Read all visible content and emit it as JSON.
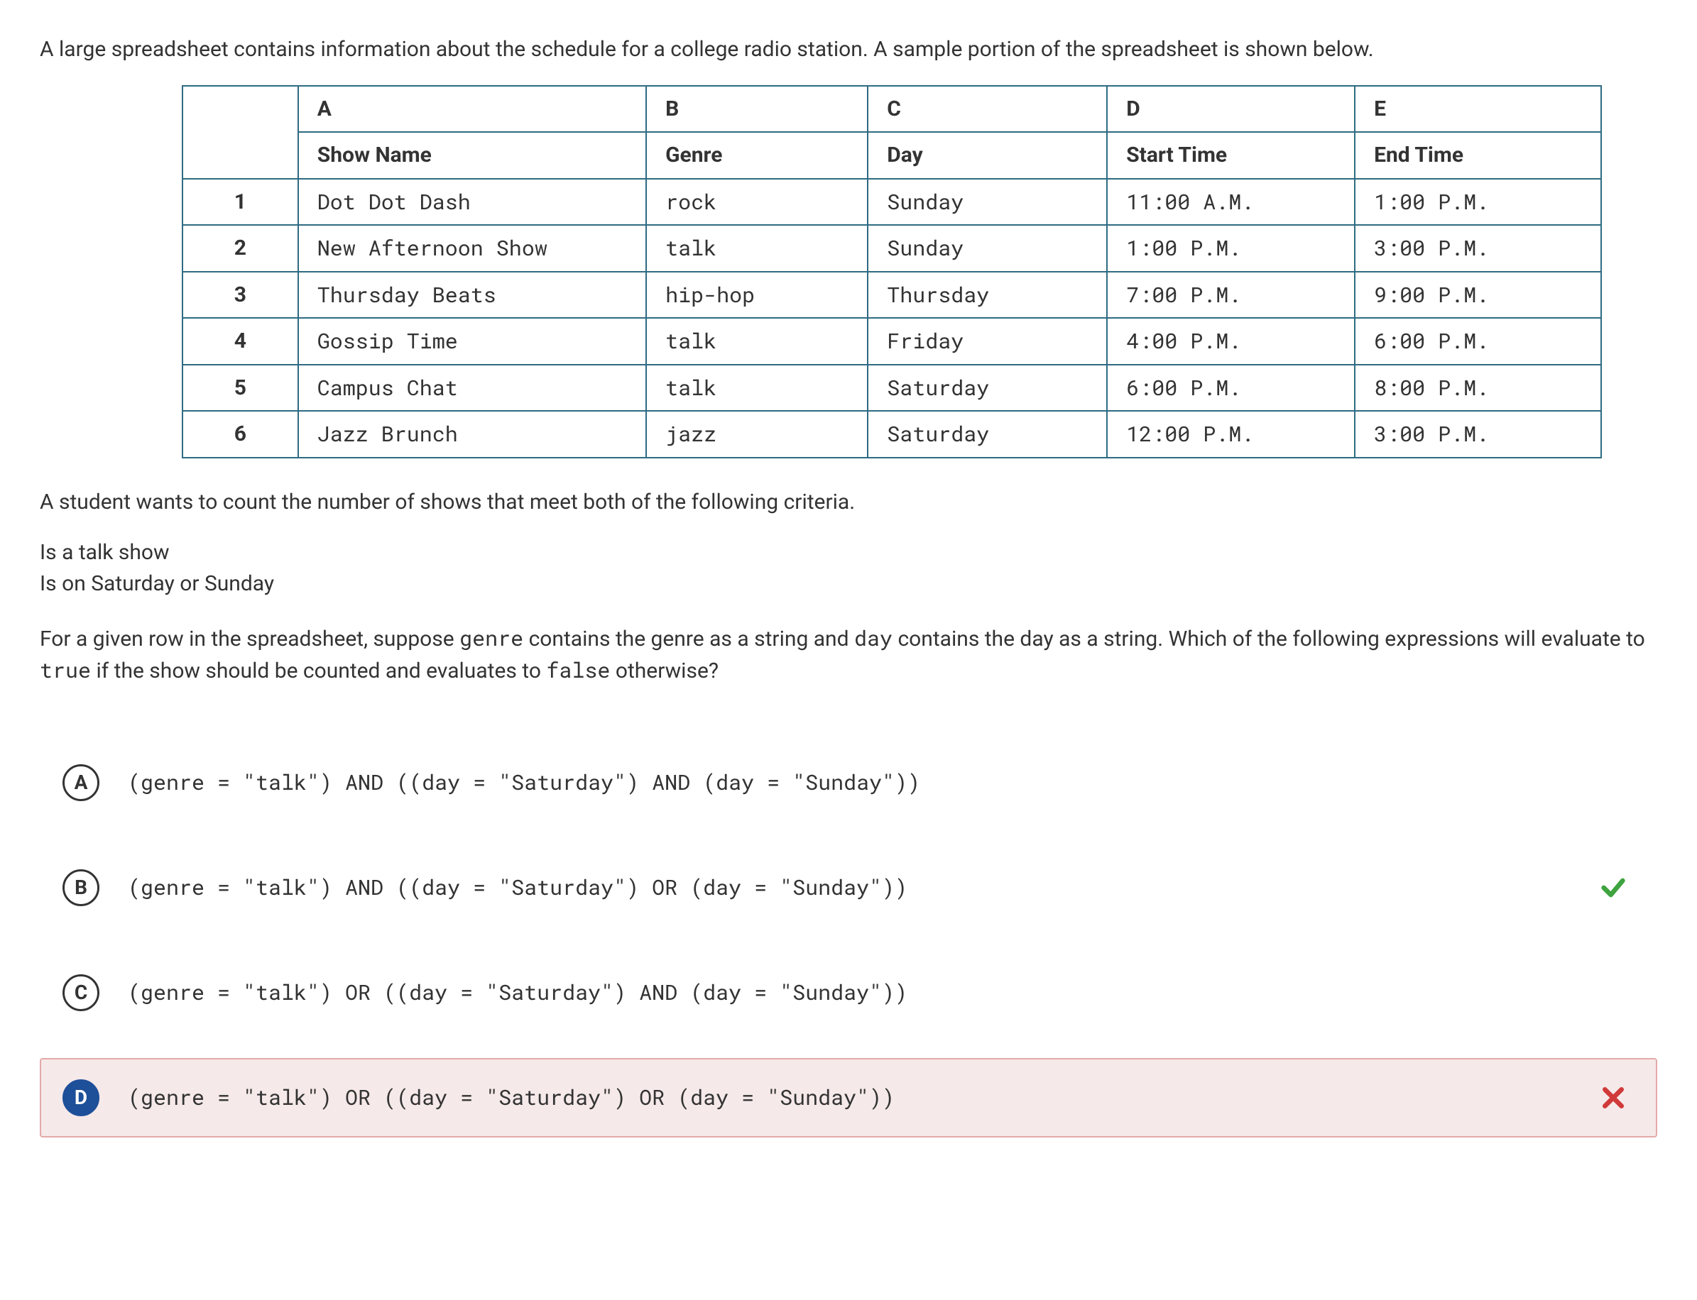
{
  "intro": "A large spreadsheet contains information about the schedule for a college radio station. A sample portion of the spreadsheet is shown below.",
  "table": {
    "cols": [
      "A",
      "B",
      "C",
      "D",
      "E"
    ],
    "headers": [
      "Show Name",
      "Genre",
      "Day",
      "Start Time",
      "End Time"
    ],
    "rows": [
      {
        "n": "1",
        "cells": [
          "Dot Dot Dash",
          "rock",
          "Sunday",
          "11:00 A.M.",
          "1:00 P.M."
        ]
      },
      {
        "n": "2",
        "cells": [
          "New Afternoon Show",
          "talk",
          "Sunday",
          "1:00 P.M.",
          "3:00 P.M."
        ]
      },
      {
        "n": "3",
        "cells": [
          "Thursday Beats",
          "hip-hop",
          "Thursday",
          "7:00 P.M.",
          "9:00 P.M."
        ]
      },
      {
        "n": "4",
        "cells": [
          "Gossip Time",
          "talk",
          "Friday",
          "4:00 P.M.",
          "6:00 P.M."
        ]
      },
      {
        "n": "5",
        "cells": [
          "Campus Chat",
          "talk",
          "Saturday",
          "6:00 P.M.",
          "8:00 P.M."
        ]
      },
      {
        "n": "6",
        "cells": [
          "Jazz Brunch",
          "jazz",
          "Saturday",
          "12:00 P.M.",
          "3:00 P.M."
        ]
      }
    ]
  },
  "prompt2": "A student wants to count the number of shows that meet both of the following criteria.",
  "criteria": [
    "Is a talk show",
    "Is on Saturday or Sunday"
  ],
  "prompt3_pre": "For a given row in the spreadsheet, suppose ",
  "code_genre": "genre",
  "prompt3_mid1": " contains the genre as a string and ",
  "code_day": "day",
  "prompt3_mid2": " contains the day as a string. Which of the following expressions will evaluate to ",
  "code_true": "true",
  "prompt3_mid3": " if the show should be counted and evaluates to ",
  "code_false": "false",
  "prompt3_end": " otherwise?",
  "answers": [
    {
      "letter": "A",
      "text": "(genre = \"talk\") AND ((day = \"Saturday\") AND (day = \"Sunday\"))",
      "correct": false,
      "selected": false
    },
    {
      "letter": "B",
      "text": "(genre = \"talk\") AND ((day = \"Saturday\") OR (day = \"Sunday\"))",
      "correct": true,
      "selected": false
    },
    {
      "letter": "C",
      "text": "(genre = \"talk\") OR ((day = \"Saturday\") AND (day = \"Sunday\"))",
      "correct": false,
      "selected": false
    },
    {
      "letter": "D",
      "text": "(genre = \"talk\") OR ((day = \"Saturday\") OR (day = \"Sunday\"))",
      "correct": false,
      "selected": true
    }
  ]
}
